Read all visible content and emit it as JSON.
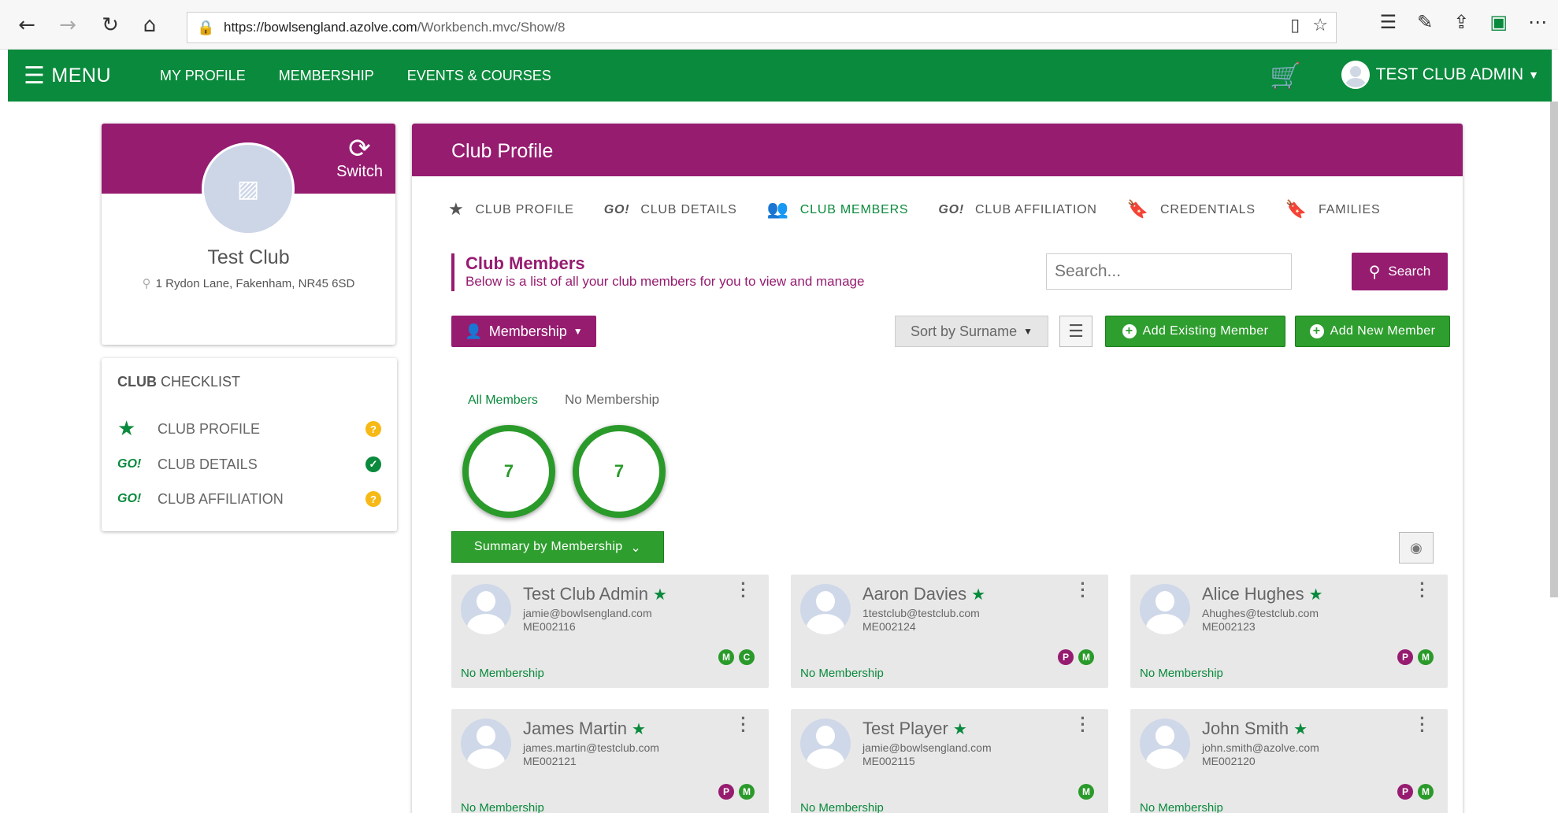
{
  "browser": {
    "url_host": "https://bowlsengland.azolve.com",
    "url_path": "/Workbench.mvc/Show/8"
  },
  "navbar": {
    "menu_label": "MENU",
    "links": [
      "MY PROFILE",
      "MEMBERSHIP",
      "EVENTS & COURSES"
    ],
    "user_label": "TEST CLUB ADMIN"
  },
  "club": {
    "switch_label": "Switch",
    "name": "Test Club",
    "address": "1 Rydon Lane, Fakenham, NR45 6SD"
  },
  "checklist": {
    "title_bold": "CLUB",
    "title_rest": " CHECKLIST",
    "items": [
      {
        "icon": "GO!",
        "label": "CLUB PROFILE",
        "status": "?"
      },
      {
        "icon": "GO!",
        "label": "CLUB DETAILS",
        "status": "✓"
      },
      {
        "icon": "GO!",
        "label": "CLUB AFFILIATION",
        "status": "?"
      }
    ]
  },
  "main": {
    "header": "Club Profile",
    "tabs": [
      {
        "icon": "★",
        "label": "CLUB PROFILE"
      },
      {
        "icon": "GO!",
        "label": "CLUB DETAILS"
      },
      {
        "icon": "👥",
        "label": "CLUB MEMBERS"
      },
      {
        "icon": "GO!",
        "label": "CLUB AFFILIATION"
      },
      {
        "icon": "🔖",
        "label": "CREDENTIALS"
      },
      {
        "icon": "🔖",
        "label": "FAMILIES"
      }
    ],
    "section_title": "Club Members",
    "section_subtitle": "Below is a list of all your club members for you to view and manage",
    "search_placeholder": "Search...",
    "search_button": "Search",
    "membership_button": "Membership",
    "sort_label": "Sort by Surname",
    "add_existing": "Add Existing Member",
    "add_new": "Add New Member",
    "filters": [
      {
        "label": "All Members",
        "count": "7"
      },
      {
        "label": "No Membership",
        "count": "7"
      }
    ],
    "summary_button": "Summary by Membership"
  },
  "members": [
    {
      "name": "Test Club Admin",
      "email": "jamie@bowlsengland.com",
      "id": "ME002116",
      "badges": [
        "M",
        "C"
      ],
      "membership": "No Membership"
    },
    {
      "name": "Aaron Davies",
      "email": "1testclub@testclub.com",
      "id": "ME002124",
      "badges": [
        "P",
        "M"
      ],
      "membership": "No Membership"
    },
    {
      "name": "Alice Hughes",
      "email": "Ahughes@testclub.com",
      "id": "ME002123",
      "badges": [
        "P",
        "M"
      ],
      "membership": "No Membership"
    },
    {
      "name": "James Martin",
      "email": "james.martin@testclub.com",
      "id": "ME002121",
      "badges": [
        "P",
        "M"
      ],
      "membership": "No Membership"
    },
    {
      "name": "Test Player",
      "email": "jamie@bowlsengland.com",
      "id": "ME002115",
      "badges": [
        "M"
      ],
      "membership": "No Membership"
    },
    {
      "name": "John Smith",
      "email": "john.smith@azolve.com",
      "id": "ME002120",
      "badges": [
        "P",
        "M"
      ],
      "membership": "No Membership"
    }
  ],
  "colors": {
    "green": "#0a8a3c",
    "purple": "#961c70"
  }
}
